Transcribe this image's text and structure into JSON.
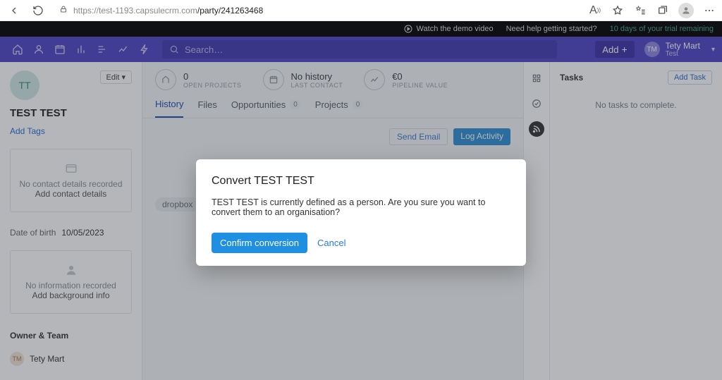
{
  "chrome": {
    "url_host": "https://test-1193.capsulecrm.com",
    "url_path": "/party/241263468"
  },
  "blackbar": {
    "demo": "Watch the demo video",
    "help": "Need help getting started?",
    "trial": "10 days of your trial remaining"
  },
  "nav": {
    "search_placeholder": "Search…",
    "add": "Add",
    "profile_initials": "TM",
    "profile_name": "Tety Mart",
    "profile_sub": "Test"
  },
  "sidebar": {
    "avatar": "TT",
    "edit": "Edit",
    "name": "TEST TEST",
    "add_tags": "Add Tags",
    "panel1_line1": "No contact details recorded",
    "panel1_line2": "Add contact details",
    "dob_label": "Date of birth",
    "dob_value": "10/05/2023",
    "panel2_line1": "No information recorded",
    "panel2_line2": "Add background info",
    "owner_header": "Owner & Team",
    "owner_initials": "TM",
    "owner_name": "Tety Mart"
  },
  "stats": {
    "s1_val": "0",
    "s1_lab": "OPEN PROJECTS",
    "s2_val": "No history",
    "s2_lab": "LAST CONTACT",
    "s3_val": "€0",
    "s3_lab": "PIPELINE VALUE"
  },
  "tabs": {
    "t1": "History",
    "t2": "Files",
    "t3": "Opportunities",
    "t3_count": "0",
    "t4": "Projects",
    "t4_count": "0"
  },
  "actions": {
    "email": "Send Email",
    "log": "Log Activity"
  },
  "pill": "dropbox",
  "right": {
    "header": "Tasks",
    "add": "Add Task",
    "empty": "No tasks to complete."
  },
  "modal": {
    "title": "Convert TEST TEST",
    "body": "TEST TEST is currently defined as a person. Are you sure you want to convert them to an organisation?",
    "confirm": "Confirm conversion",
    "cancel": "Cancel"
  }
}
